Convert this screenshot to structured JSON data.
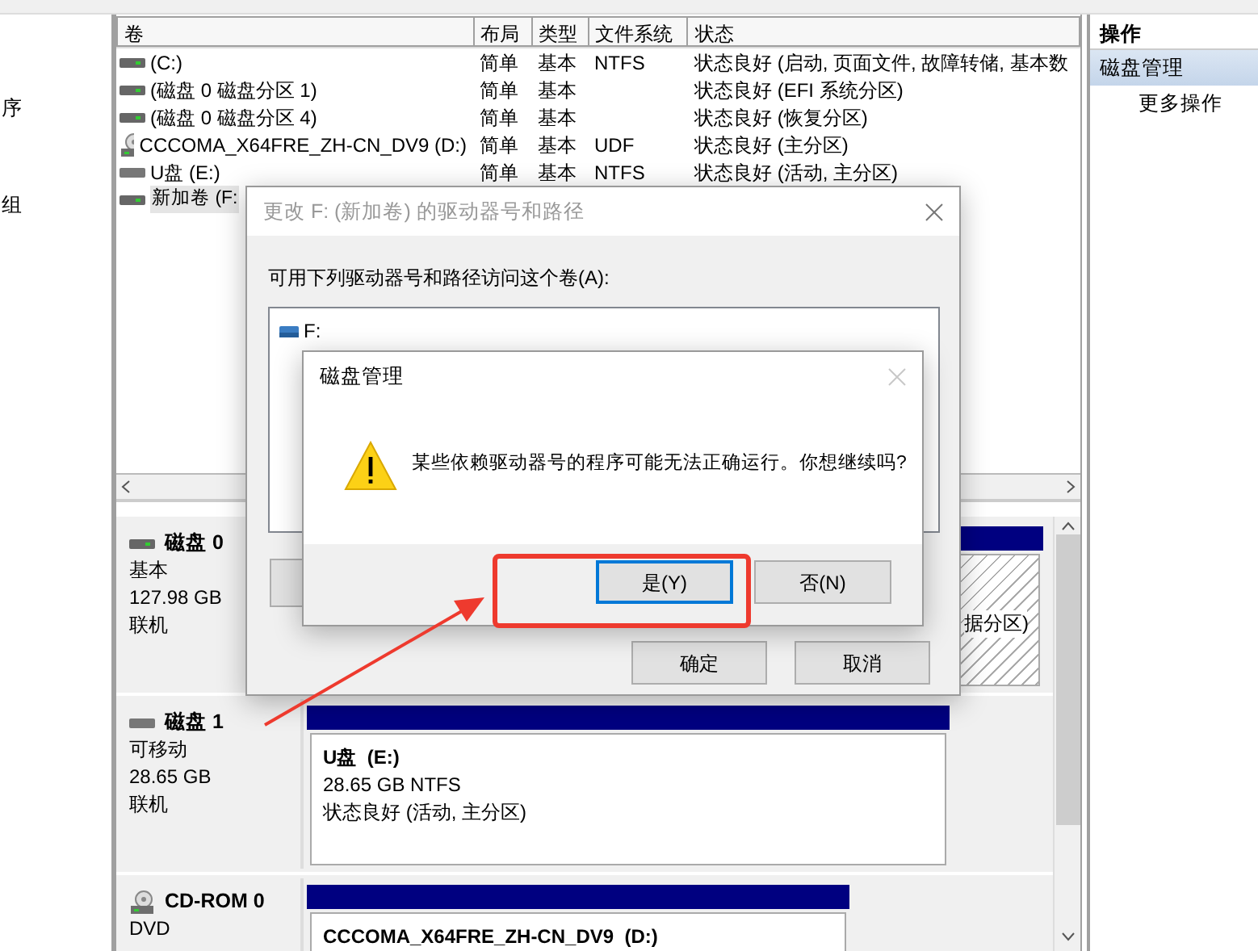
{
  "navigation_tree": {
    "items": [
      {
        "label": "序"
      },
      {
        "label": "组"
      }
    ]
  },
  "volumes": {
    "columns": [
      "卷",
      "布局",
      "类型",
      "文件系统",
      "状态"
    ],
    "rows": [
      {
        "kind": "disk",
        "volume": "(C:)",
        "layout": "简单",
        "type": "基本",
        "filesystem": "NTFS",
        "status": "状态良好 (启动, 页面文件, 故障转储, 基本数",
        "selected": false
      },
      {
        "kind": "disk",
        "volume": "(磁盘 0 磁盘分区 1)",
        "layout": "简单",
        "type": "基本",
        "status": "状态良好 (EFI 系统分区)",
        "selected": false
      },
      {
        "kind": "disk",
        "volume": "(磁盘 0 磁盘分区 4)",
        "layout": "简单",
        "type": "基本",
        "status": "状态良好 (恢复分区)",
        "selected": false
      },
      {
        "kind": "cd",
        "volume": "CCCOMA_X64FRE_ZH-CN_DV9 (D:)",
        "layout": "简单",
        "type": "基本",
        "filesystem": "UDF",
        "status": "状态良好 (主分区)",
        "selected": false
      },
      {
        "kind": "usb",
        "volume": "U盘 (E:)",
        "layout": "简单",
        "type": "基本",
        "filesystem": "NTFS",
        "status": "状态良好 (活动, 主分区)",
        "selected": false
      },
      {
        "kind": "disk",
        "volume": "新加卷 (F:",
        "selected": true
      }
    ]
  },
  "disks": [
    {
      "kind": "disk",
      "name": "磁盘 0",
      "details": [
        "基本",
        "127.98 GB",
        "联机"
      ],
      "partitions": [
        {
          "hatched": true,
          "lines": [
            "据分区)"
          ]
        }
      ]
    },
    {
      "kind": "usb",
      "name": "磁盘 1",
      "details": [
        "可移动",
        "28.65 GB",
        "联机"
      ],
      "partitions": [
        {
          "hatched": false,
          "title": "U盘  (E:)",
          "lines": [
            "28.65 GB NTFS",
            "状态良好 (活动, 主分区)"
          ]
        }
      ]
    },
    {
      "kind": "cd",
      "name": "CD-ROM 0",
      "details": [
        "DVD"
      ],
      "partitions": [
        {
          "hatched": false,
          "title": "CCCOMA_X64FRE_ZH-CN_DV9  (D:)"
        }
      ]
    }
  ],
  "actions": {
    "header": "操作",
    "items": [
      {
        "label": "磁盘管理",
        "selected": true
      },
      {
        "label": "更多操作",
        "selected": false
      }
    ]
  },
  "change_letter_dialog": {
    "title": "更改 F: (新加卷) 的驱动器号和路径",
    "active": false,
    "label": "可用下列驱动器号和路径访问这个卷(A):",
    "paths": [
      {
        "label": "F:"
      }
    ],
    "buttons": [
      "确定",
      "取消"
    ]
  },
  "confirm_dialog": {
    "title": "磁盘管理",
    "message": "某些依赖驱动器号的程序可能无法正确运行。你想继续吗?",
    "buttons": [
      {
        "label": "是(Y)",
        "default": true
      },
      {
        "label": "否(N)",
        "default": false
      }
    ]
  }
}
